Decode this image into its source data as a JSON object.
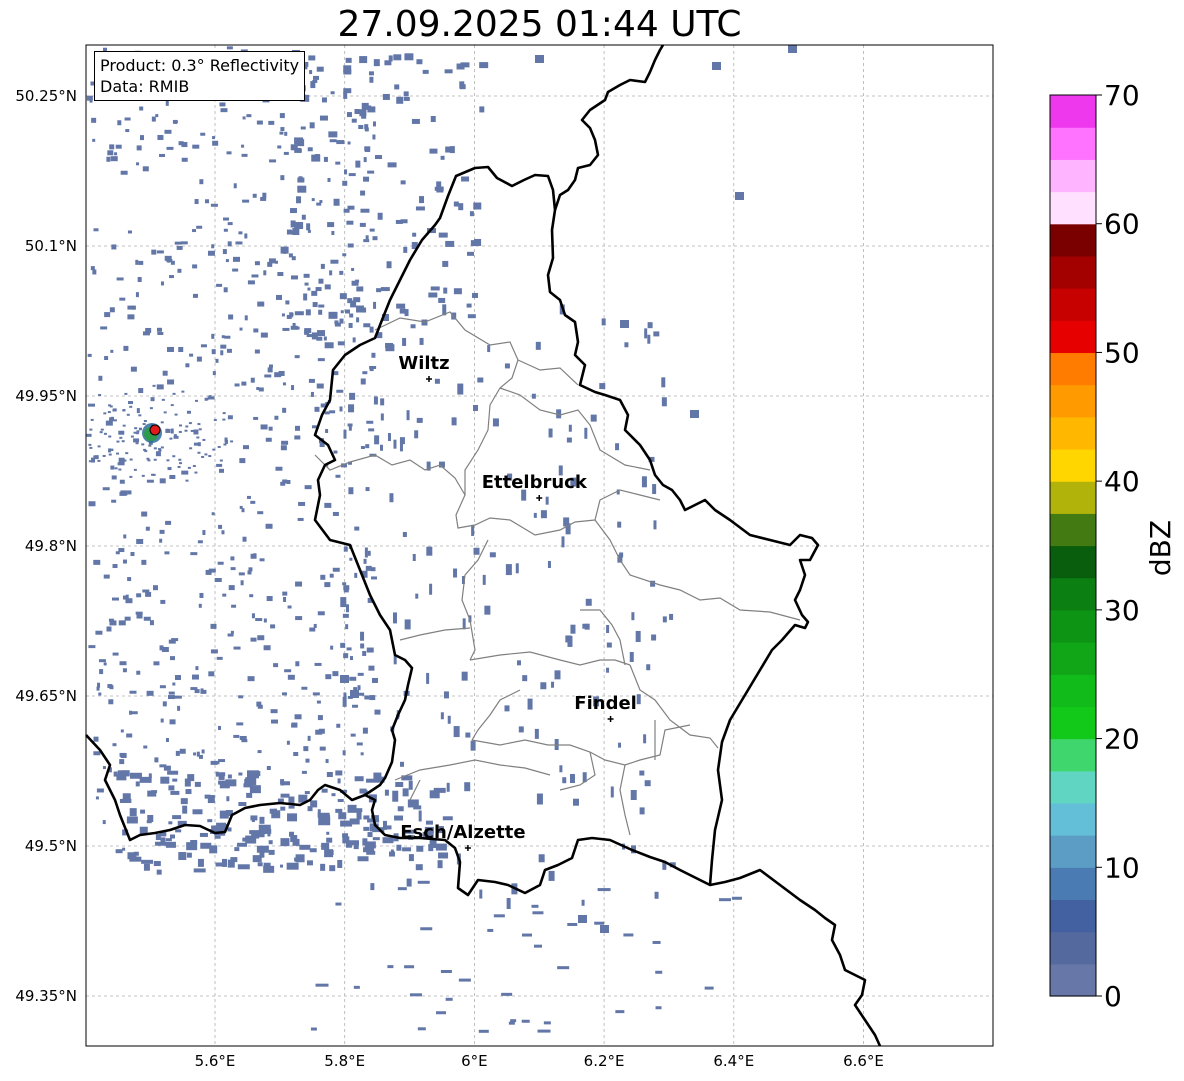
{
  "title": "27.09.2025 01:44 UTC",
  "info": {
    "product": "Product: 0.3° Reflectivity",
    "data": "Data: RMIB"
  },
  "axes": {
    "lon_ticks": [
      "5.6°E",
      "5.8°E",
      "6°E",
      "6.2°E",
      "6.4°E",
      "6.6°E"
    ],
    "lat_ticks": [
      "50.25°N",
      "50.1°N",
      "49.95°N",
      "49.8°N",
      "49.65°N",
      "49.5°N",
      "49.35°N"
    ],
    "gridlines": true
  },
  "cities": [
    {
      "name": "Wiltz",
      "lon": 5.93,
      "lat": 49.967
    },
    {
      "name": "Ettelbruck",
      "lon": 6.1,
      "lat": 49.848
    },
    {
      "name": "Findel",
      "lon": 6.21,
      "lat": 49.627
    },
    {
      "name": "Esch/Alzette",
      "lon": 5.99,
      "lat": 49.498
    }
  ],
  "radar_site": {
    "color": "#e31a1c"
  },
  "colorbar": {
    "label": "dBZ",
    "tick_labels": [
      "0",
      "10",
      "20",
      "30",
      "40",
      "50",
      "60",
      "70"
    ],
    "min": 0,
    "max": 70,
    "step": 2.5,
    "colors": [
      "#6677a8",
      "#54699e",
      "#4360a0",
      "#4a7bb2",
      "#5c9dc6",
      "#63bfd7",
      "#60d5c1",
      "#3fd66d",
      "#12c91a",
      "#11bb19",
      "#10a617",
      "#0e9414",
      "#0c7f12",
      "#085e0c",
      "#447a12",
      "#b2b30a",
      "#ffd600",
      "#ffb700",
      "#ff9a00",
      "#ff7c00",
      "#e60000",
      "#c70000",
      "#a30000",
      "#7a0000",
      "#ffe0ff",
      "#ffb4ff",
      "#ff73ff",
      "#ee38ee"
    ]
  },
  "echo_color": "#6277a8"
}
